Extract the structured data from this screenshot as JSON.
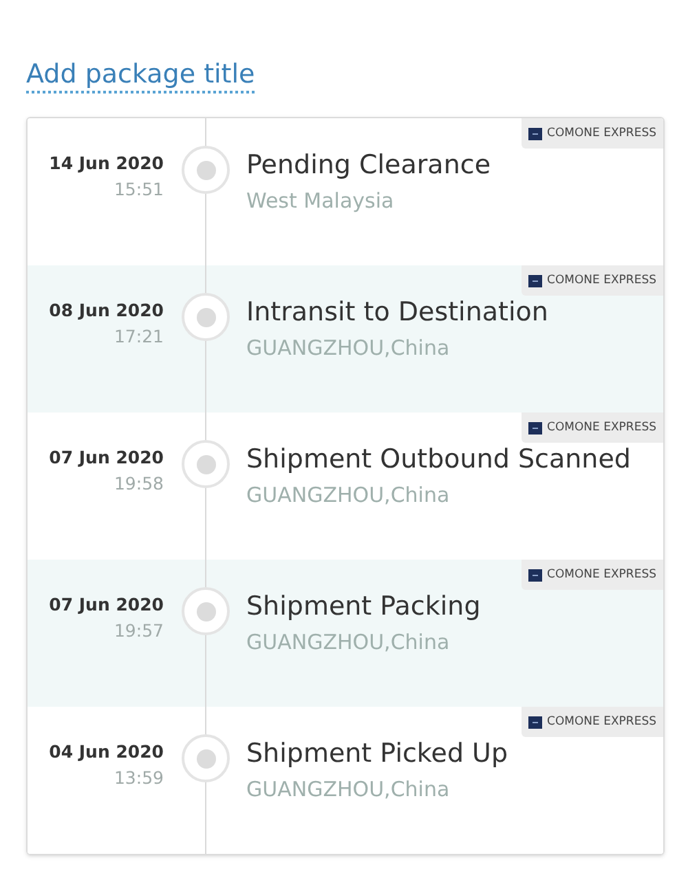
{
  "title": "Add package title",
  "events": [
    {
      "date": "14 Jun 2020",
      "time": "15:51",
      "status": "Pending Clearance",
      "location": "West Malaysia",
      "carrier": "COMONE EXPRESS"
    },
    {
      "date": "08 Jun 2020",
      "time": "17:21",
      "status": "Intransit to Destination",
      "location": "GUANGZHOU,China",
      "carrier": "COMONE EXPRESS"
    },
    {
      "date": "07 Jun 2020",
      "time": "19:58",
      "status": "Shipment Outbound Scanned",
      "location": "GUANGZHOU,China",
      "carrier": "COMONE EXPRESS"
    },
    {
      "date": "07 Jun 2020",
      "time": "19:57",
      "status": "Shipment Packing",
      "location": "GUANGZHOU,China",
      "carrier": "COMONE EXPRESS"
    },
    {
      "date": "04 Jun 2020",
      "time": "13:59",
      "status": "Shipment Picked Up",
      "location": "GUANGZHOU,China",
      "carrier": "COMONE EXPRESS"
    }
  ]
}
